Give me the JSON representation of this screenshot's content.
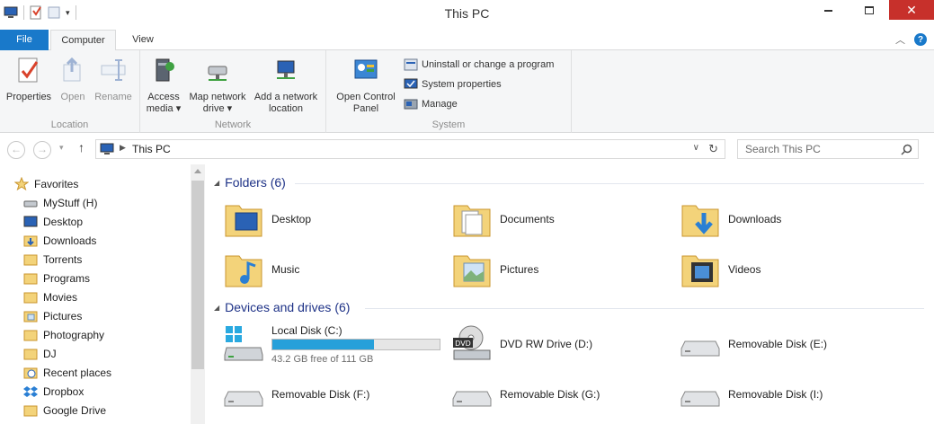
{
  "window": {
    "title": "This PC"
  },
  "ribbon": {
    "tabs": [
      "File",
      "Computer",
      "View"
    ],
    "groups": {
      "location": {
        "label": "Location",
        "buttons": [
          "Properties",
          "Open",
          "Rename"
        ]
      },
      "network": {
        "label": "Network",
        "buttons": [
          {
            "line1": "Access",
            "line2": "media ▾"
          },
          {
            "line1": "Map network",
            "line2": "drive ▾"
          },
          {
            "line1": "Add a network",
            "line2": "location"
          }
        ]
      },
      "system": {
        "label": "System",
        "open_control_panel": {
          "line1": "Open Control",
          "line2": "Panel"
        },
        "small": [
          "Uninstall or change a program",
          "System properties",
          "Manage"
        ]
      }
    }
  },
  "address": {
    "path": "This PC",
    "search_placeholder": "Search This PC"
  },
  "nav": {
    "favorites": "Favorites",
    "items": [
      "MyStuff (H)",
      "Desktop",
      "Downloads",
      "Torrents",
      "Programs",
      "Movies",
      "Pictures",
      "Photography",
      "DJ",
      "Recent places",
      "Dropbox",
      "Google Drive"
    ]
  },
  "folders": {
    "header": "Folders (6)",
    "items": [
      "Desktop",
      "Documents",
      "Downloads",
      "Music",
      "Pictures",
      "Videos"
    ]
  },
  "drives": {
    "header": "Devices and drives (6)",
    "local": {
      "name": "Local Disk (C:)",
      "free": "43.2 GB free of 111 GB",
      "used_fraction": 0.61
    },
    "items": [
      "DVD RW Drive (D:)",
      "Removable Disk (E:)",
      "Removable Disk (F:)",
      "Removable Disk (G:)",
      "Removable Disk (I:)"
    ],
    "dvd_label": "DVD"
  },
  "colors": {
    "accent": "#1979ca",
    "section": "#1e3287",
    "bar_fill": "#26a0da",
    "close": "#c7302b"
  }
}
